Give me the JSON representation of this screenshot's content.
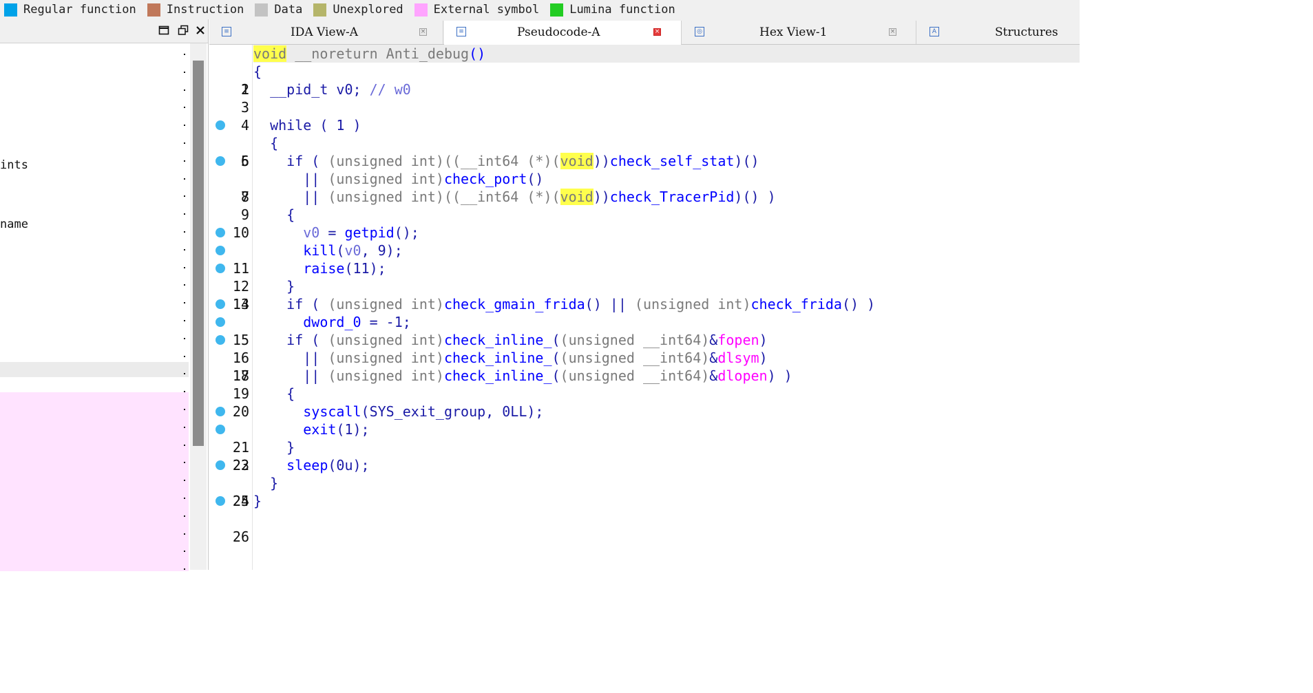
{
  "legend": [
    {
      "label": "Regular function",
      "color": "#00a2e8"
    },
    {
      "label": "Instruction",
      "color": "#c0785a"
    },
    {
      "label": "Data",
      "color": "#c3c3c3"
    },
    {
      "label": "Unexplored",
      "color": "#b5b56a"
    },
    {
      "label": "External symbol",
      "color": "#ffa4ff"
    },
    {
      "label": "Lumina function",
      "color": "#22cc22"
    }
  ],
  "left_panel": {
    "visible_texts": [
      "ints",
      "name"
    ],
    "window_buttons": {
      "maximize": "maximize-icon",
      "float": "float-icon",
      "close": "close-icon"
    }
  },
  "tabs": [
    {
      "label": "IDA View-A",
      "icon": "disassembly-icon",
      "active": false
    },
    {
      "label": "Pseudocode-A",
      "icon": "pseudocode-icon",
      "active": true
    },
    {
      "label": "Hex View-1",
      "icon": "hex-icon",
      "active": false
    },
    {
      "label": "Structures",
      "icon": "structures-icon",
      "active": false
    }
  ],
  "code": {
    "lines": [
      {
        "num": "1",
        "bp": false
      },
      {
        "num": "2",
        "bp": false
      },
      {
        "num": "3",
        "bp": false
      },
      {
        "num": "4",
        "bp": false
      },
      {
        "num": "5",
        "bp": true
      },
      {
        "num": "6",
        "bp": false
      },
      {
        "num": "7",
        "bp": true
      },
      {
        "num": "8",
        "bp": false
      },
      {
        "num": "9",
        "bp": false
      },
      {
        "num": "10",
        "bp": false
      },
      {
        "num": "11",
        "bp": true
      },
      {
        "num": "12",
        "bp": true
      },
      {
        "num": "13",
        "bp": true
      },
      {
        "num": "14",
        "bp": false
      },
      {
        "num": "15",
        "bp": true
      },
      {
        "num": "16",
        "bp": true
      },
      {
        "num": "17",
        "bp": true
      },
      {
        "num": "18",
        "bp": false
      },
      {
        "num": "19",
        "bp": false
      },
      {
        "num": "20",
        "bp": false
      },
      {
        "num": "21",
        "bp": true
      },
      {
        "num": "22",
        "bp": true
      },
      {
        "num": "23",
        "bp": false
      },
      {
        "num": "24",
        "bp": true
      },
      {
        "num": "25",
        "bp": false
      },
      {
        "num": "26",
        "bp": true
      }
    ],
    "tokens": {
      "l1": [
        "void",
        " __noreturn ",
        "Anti_debug",
        "()"
      ],
      "l2": [
        "{"
      ],
      "l3": [
        "  __pid_t v0; ",
        "// w0"
      ],
      "l5": [
        "  while ( 1 )"
      ],
      "l6": [
        "  {"
      ],
      "l7": [
        "    if ( ",
        "(unsigned int)((__int64 (*)(",
        "void",
        "))",
        "check_self_stat",
        ")()"
      ],
      "l8": [
        "      || ",
        "(unsigned int)",
        "check_port",
        "()"
      ],
      "l9": [
        "      || ",
        "(unsigned int)((__int64 (*)(",
        "void",
        "))",
        "check_TracerPid",
        ")() )"
      ],
      "l10": [
        "    {"
      ],
      "l11": [
        "      ",
        "v0",
        " = ",
        "getpid",
        "();"
      ],
      "l12": [
        "      ",
        "kill",
        "(",
        "v0",
        ", 9);"
      ],
      "l13": [
        "      ",
        "raise",
        "(11);"
      ],
      "l14": [
        "    }"
      ],
      "l15": [
        "    if ( ",
        "(unsigned int)",
        "check_gmain_frida",
        "() || ",
        "(unsigned int)",
        "check_frida",
        "() )"
      ],
      "l16": [
        "      ",
        "dword_0",
        " = -1;"
      ],
      "l17": [
        "    if ( ",
        "(unsigned int)",
        "check_inline_",
        "(",
        "(unsigned __int64)",
        "&",
        "fopen",
        ")"
      ],
      "l18": [
        "      || ",
        "(unsigned int)",
        "check_inline_",
        "(",
        "(unsigned __int64)",
        "&",
        "dlsym",
        ")"
      ],
      "l19": [
        "      || ",
        "(unsigned int)",
        "check_inline_",
        "(",
        "(unsigned __int64)",
        "&",
        "dlopen",
        ") )"
      ],
      "l20": [
        "    {"
      ],
      "l21": [
        "      ",
        "syscall",
        "(SYS_exit_group, 0LL);"
      ],
      "l22": [
        "      ",
        "exit",
        "(1);"
      ],
      "l23": [
        "    }"
      ],
      "l24": [
        "    ",
        "sleep",
        "(0u);"
      ],
      "l25": [
        "  }"
      ],
      "l26": [
        "}"
      ]
    }
  }
}
